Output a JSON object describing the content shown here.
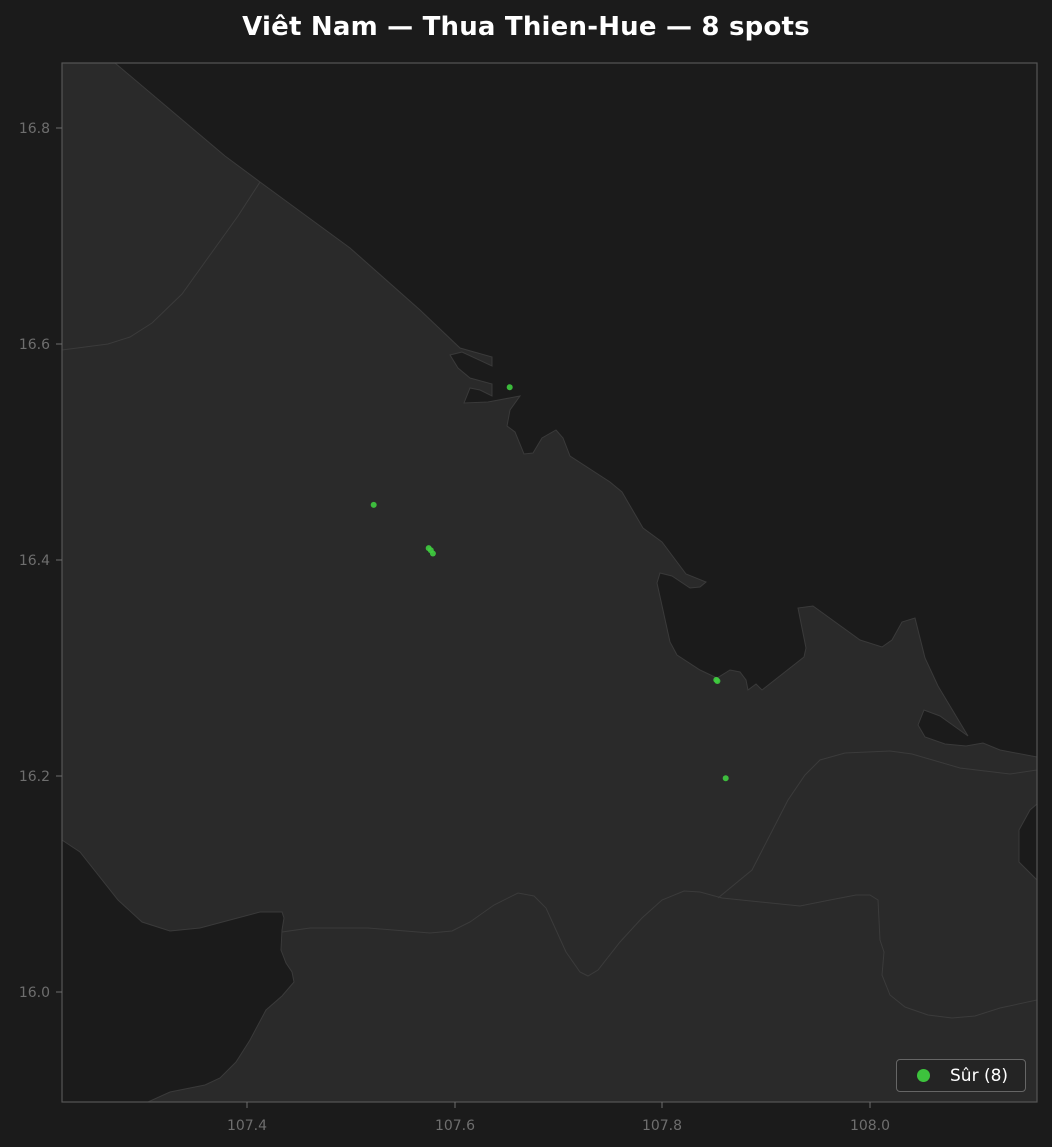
{
  "map": {
    "title": "Viêt Nam — Thua Thien-Hue — 8 spots",
    "x_ticks": [
      "107.4",
      "107.6",
      "107.8",
      "108.0"
    ],
    "y_ticks": [
      "16.8",
      "16.6",
      "16.4",
      "16.2",
      "16.0"
    ],
    "legend": {
      "label": "Sûr (8)",
      "color": "#3fcc3f"
    },
    "colors": {
      "background": "#1b1b1b",
      "land": "#2a2a2a",
      "water": "#1b1b1b",
      "border": "#3c3c3c",
      "point": "#3fcc3f"
    },
    "points": [
      {
        "lon": 107.653,
        "lat": 16.56
      },
      {
        "lon": 107.522,
        "lat": 16.451
      },
      {
        "lon": 107.575,
        "lat": 16.411
      },
      {
        "lon": 107.577,
        "lat": 16.409
      },
      {
        "lon": 107.579,
        "lat": 16.406
      },
      {
        "lon": 107.852,
        "lat": 16.289
      },
      {
        "lon": 107.853,
        "lat": 16.288
      },
      {
        "lon": 107.861,
        "lat": 16.198
      }
    ]
  }
}
